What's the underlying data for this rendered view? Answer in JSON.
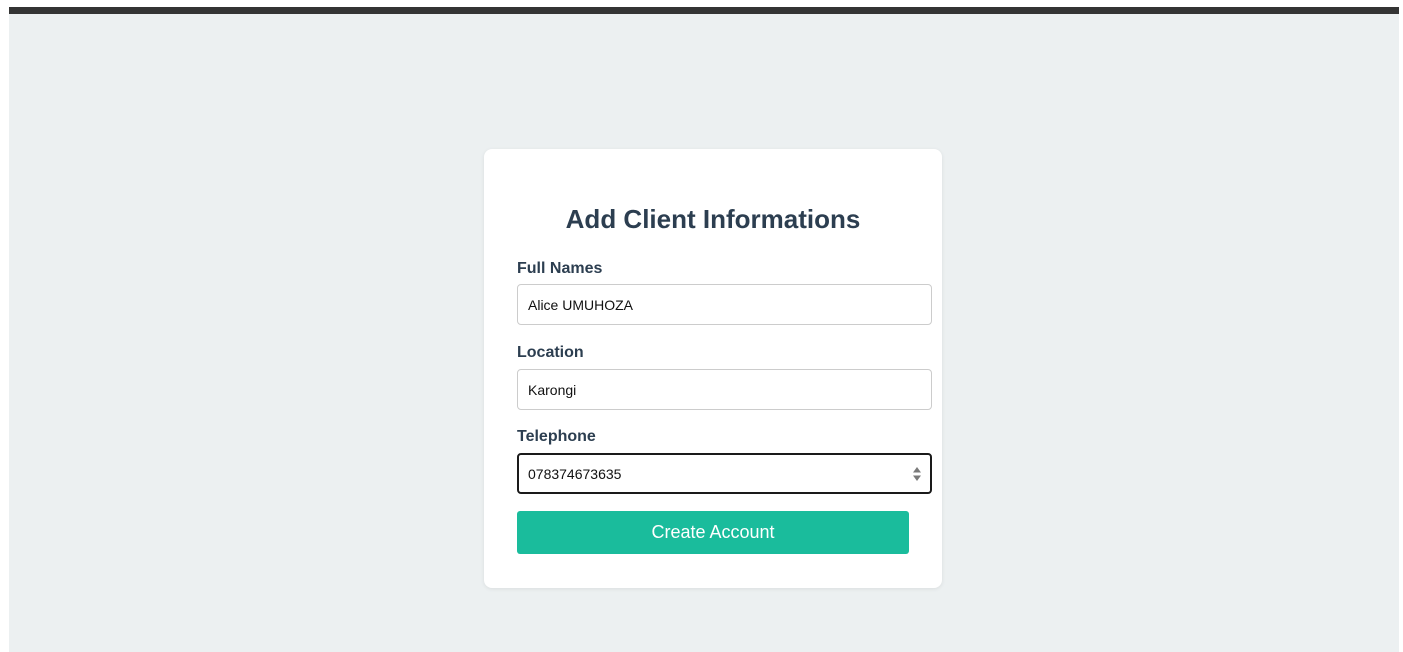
{
  "form": {
    "title": "Add Client Informations",
    "fields": [
      {
        "label": "Full Names",
        "value": "Alice UMUHOZA"
      },
      {
        "label": "Location",
        "value": "Karongi"
      },
      {
        "label": "Telephone",
        "value": "078374673635"
      }
    ],
    "submit_label": "Create Account"
  },
  "colors": {
    "page_background": "#ecf0f1",
    "top_bar": "#343434",
    "heading_text": "#2c3e50",
    "button_background": "#1abc9c",
    "button_text": "#ffffff"
  },
  "icons": {
    "telephone_spinner": "up-down-spinner-icon"
  }
}
